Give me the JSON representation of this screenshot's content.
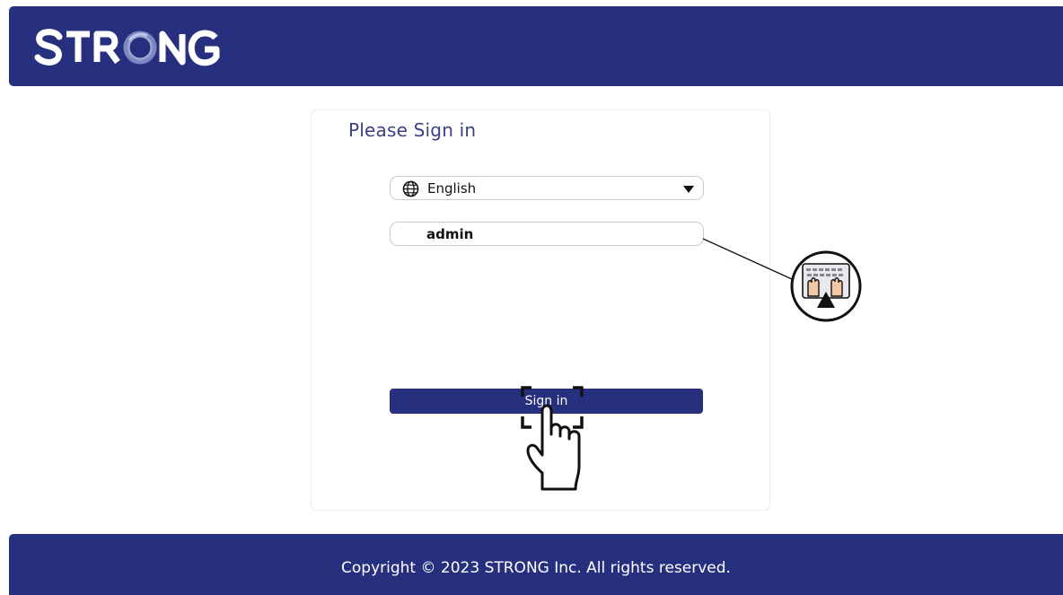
{
  "header": {
    "logo_text": "STRONG",
    "background_color": "#27307e"
  },
  "login": {
    "title": "Please Sign in",
    "language": {
      "selected": "English",
      "icon": "globe-icon",
      "caret": "caret-down-icon"
    },
    "username": {
      "value": "admin"
    },
    "signin_label": "Sign in"
  },
  "annotations": {
    "keyboard_callout_icon": "keyboard-typing-hands-icon",
    "tap_gesture_icon": "hand-pointer-tap-icon"
  },
  "footer": {
    "copyright": "Copyright © 2023  STRONG Inc. All rights  reserved."
  }
}
